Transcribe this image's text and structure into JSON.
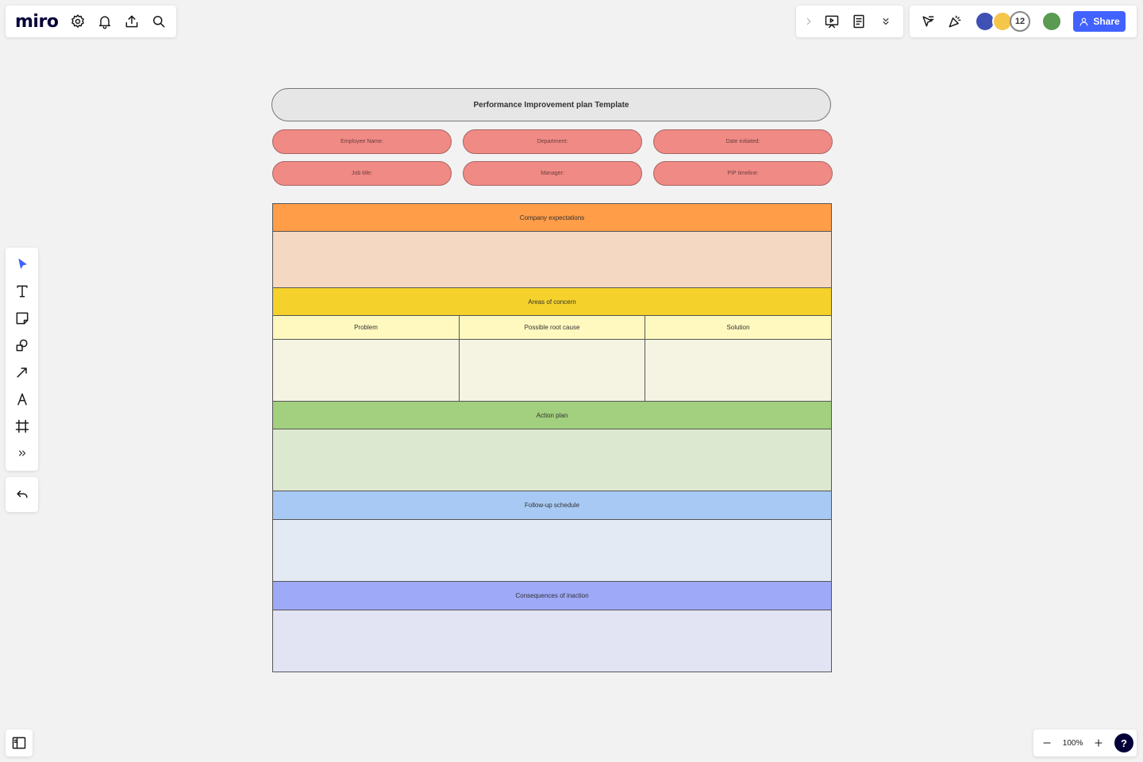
{
  "app": {
    "logo": "miro"
  },
  "toolbar": {
    "share_label": "Share",
    "collaborator_count": "12"
  },
  "zoom": {
    "level": "100%",
    "help": "?"
  },
  "board": {
    "title": "Performance Improvement plan Template",
    "fields": [
      "Employee Name:",
      "Department:",
      "Date initiated:",
      "Job title:",
      "Manager:",
      "PIP timeline:"
    ],
    "sections": {
      "company_expectations": "Company expectations",
      "areas_of_concern": "Areas of concern",
      "problem": "Problem",
      "root_cause": "Possible root cause",
      "solution": "Solution",
      "action_plan": "Action plan",
      "follow_up": "Follow-up schedule",
      "consequences": "Consequences of inaction"
    }
  },
  "colors": {
    "accent": "#4262ff",
    "field_pill": "#f08a84",
    "company_header": "#ff9d48",
    "company_body": "#f5d8c2",
    "concern_header": "#f5d22b",
    "concern_sub": "#fff9c0",
    "concern_body": "#f5f4e3",
    "action_header": "#a2d07e",
    "action_body": "#dde8d0",
    "followup_header": "#a8c9f3",
    "followup_body": "#e3eaf4",
    "consequence_header": "#9ea9f7",
    "consequence_body": "#e2e4f4"
  }
}
